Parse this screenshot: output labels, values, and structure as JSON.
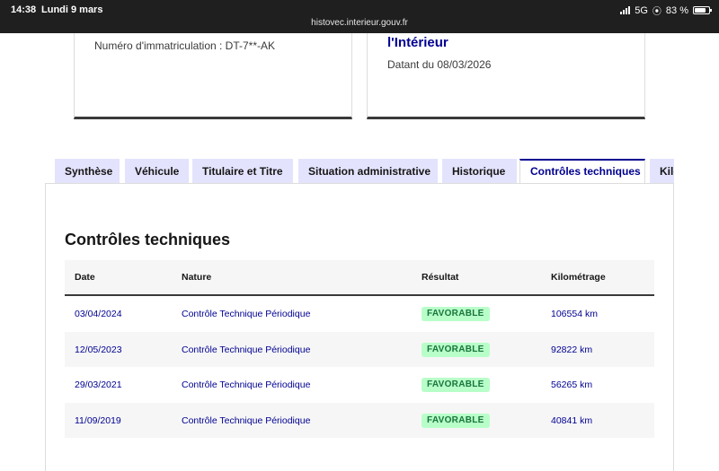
{
  "status_bar": {
    "time": "14:38",
    "date": "Lundi 9 mars",
    "network": "5G",
    "battery": "83 %",
    "battery_level": 0.83,
    "url": "histovec.interieur.gouv.fr"
  },
  "card_left": {
    "registration": "Numéro d'immatriculation : DT-7**-AK"
  },
  "card_right": {
    "title": "l'Intérieur",
    "date": "Datant du 08/03/2026"
  },
  "tabs": [
    {
      "label": "Synthèse"
    },
    {
      "label": "Véhicule"
    },
    {
      "label": "Titulaire et Titre"
    },
    {
      "label": "Situation administrative"
    },
    {
      "label": "Historique"
    },
    {
      "label": "Contrôles techniques",
      "active": true
    },
    {
      "label": "Kilométrage"
    }
  ],
  "section": {
    "title": "Contrôles techniques",
    "columns": [
      "Date",
      "Nature",
      "Résultat",
      "Kilométrage"
    ],
    "rows": [
      {
        "date": "03/04/2024",
        "nature": "Contrôle Technique Périodique",
        "result": "FAVORABLE",
        "km": "106554 km"
      },
      {
        "date": "12/05/2023",
        "nature": "Contrôle Technique Périodique",
        "result": "FAVORABLE",
        "km": "92822 km"
      },
      {
        "date": "29/03/2021",
        "nature": "Contrôle Technique Périodique",
        "result": "FAVORABLE",
        "km": "56265 km"
      },
      {
        "date": "11/09/2019",
        "nature": "Contrôle Technique Périodique",
        "result": "FAVORABLE",
        "km": "40841 km"
      }
    ]
  },
  "colors": {
    "primary": "#000091",
    "tab_bg": "#e3e3fd",
    "badge_bg": "#b8fec9",
    "badge_text": "#18753c"
  }
}
